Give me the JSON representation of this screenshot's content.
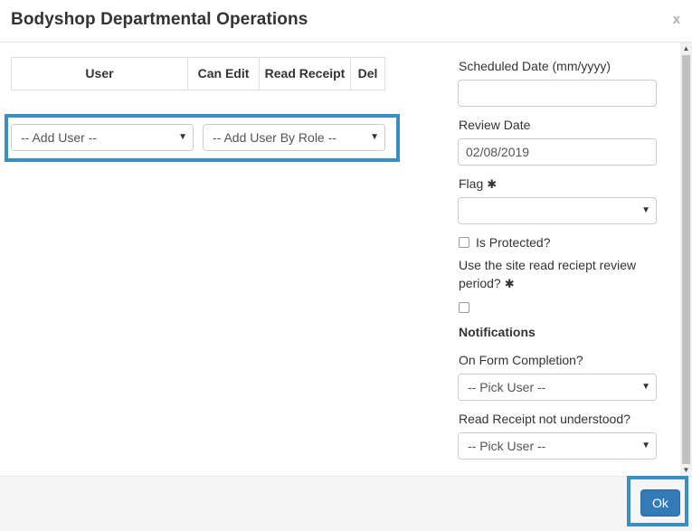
{
  "dialog": {
    "title": "Bodyshop Departmental Operations",
    "close_label": "x"
  },
  "user_table": {
    "columns": [
      "User",
      "Can Edit",
      "Read Receipt",
      "Del"
    ]
  },
  "add_user": {
    "value": "-- Add User --",
    "arrow": "▼"
  },
  "add_user_by_role": {
    "value": "-- Add User By Role --",
    "arrow": "▼"
  },
  "scheduled_date": {
    "label": "Scheduled Date (mm/yyyy)",
    "value": ""
  },
  "review_date": {
    "label": "Review Date",
    "value": "02/08/2019"
  },
  "flag": {
    "label": "Flag",
    "required_mark": "✱",
    "value": "",
    "arrow": "▼"
  },
  "is_protected": {
    "label": "Is Protected?",
    "checked": false
  },
  "site_read_receipt": {
    "label_line1": "Use the site read reciept review",
    "label_line2": "period?",
    "required_mark": "✱",
    "checked": false
  },
  "notifications": {
    "heading": "Notifications",
    "on_form_completion": {
      "label": "On Form Completion?",
      "value": "-- Pick User --",
      "arrow": "▼"
    },
    "read_receipt_not_understood": {
      "label": "Read Receipt not understood?",
      "value": "-- Pick User --",
      "arrow": "▼"
    }
  },
  "scrollbar": {
    "up": "▲",
    "down": "▼"
  },
  "footer": {
    "ok_label": "Ok"
  },
  "colors": {
    "highlight": "#3a8fc2",
    "primary_button": "#337ab7"
  }
}
